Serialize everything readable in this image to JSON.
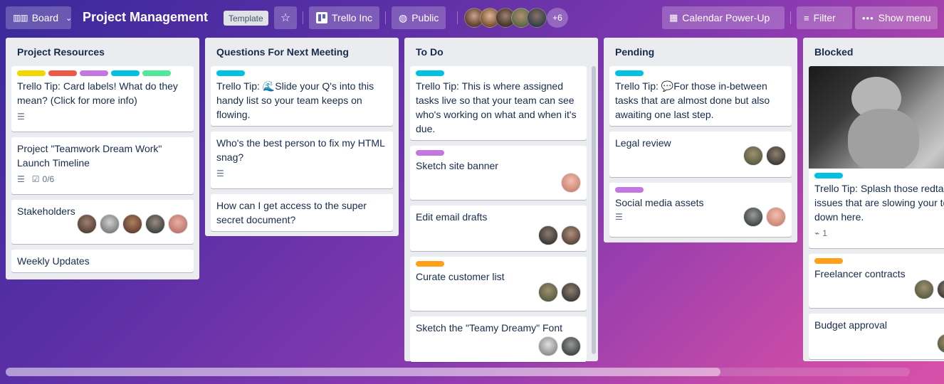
{
  "header": {
    "board_view_label": "Board",
    "board_title": "Project Management",
    "template_badge": "Template",
    "workspace_label": "Trello Inc",
    "visibility_label": "Public",
    "more_members": "+6",
    "calendar_label": "Calendar Power-Up",
    "filter_label": "Filter",
    "show_menu_label": "Show menu"
  },
  "colors": {
    "label_yellow": "#f2d600",
    "label_red": "#eb5a46",
    "label_purple": "#c377e0",
    "label_sky": "#00c2e0",
    "label_green": "#51e898",
    "label_orange": "#ff9f1a"
  },
  "lists": [
    {
      "title": "Project Resources",
      "cards": [
        {
          "title": "Trello Tip: Card labels! What do they mean? (Click for more info)"
        },
        {
          "title": "Project \"Teamwork Dream Work\" Launch Timeline",
          "checklist": "0/6"
        },
        {
          "title": "Stakeholders"
        },
        {
          "title": "Weekly Updates"
        }
      ]
    },
    {
      "title": "Questions For Next Meeting",
      "cards": [
        {
          "title": "Trello Tip: 🌊Slide your Q's into this handy list so your team keeps on flowing."
        },
        {
          "title": "Who's the best person to fix my HTML snag?"
        },
        {
          "title": "How can I get access to the super secret document?"
        }
      ]
    },
    {
      "title": "To Do",
      "cards": [
        {
          "title": "Trello Tip: This is where assigned tasks live so that your team can see who's working on what and when it's due."
        },
        {
          "title": "Sketch site banner"
        },
        {
          "title": "Edit email drafts"
        },
        {
          "title": "Curate customer list"
        },
        {
          "title": "Sketch the \"Teamy Dreamy\" Font"
        }
      ]
    },
    {
      "title": "Pending",
      "cards": [
        {
          "title": "Trello Tip: 💬For those in-between tasks that are almost done but also awaiting one last step."
        },
        {
          "title": "Legal review"
        },
        {
          "title": "Social media assets"
        }
      ]
    },
    {
      "title": "Blocked",
      "cards": [
        {
          "title": "Trello Tip: Splash those redtape-heavy issues that are slowing your team down here.",
          "attachments": "1"
        },
        {
          "title": "Freelancer contracts"
        },
        {
          "title": "Budget approval"
        }
      ]
    }
  ]
}
